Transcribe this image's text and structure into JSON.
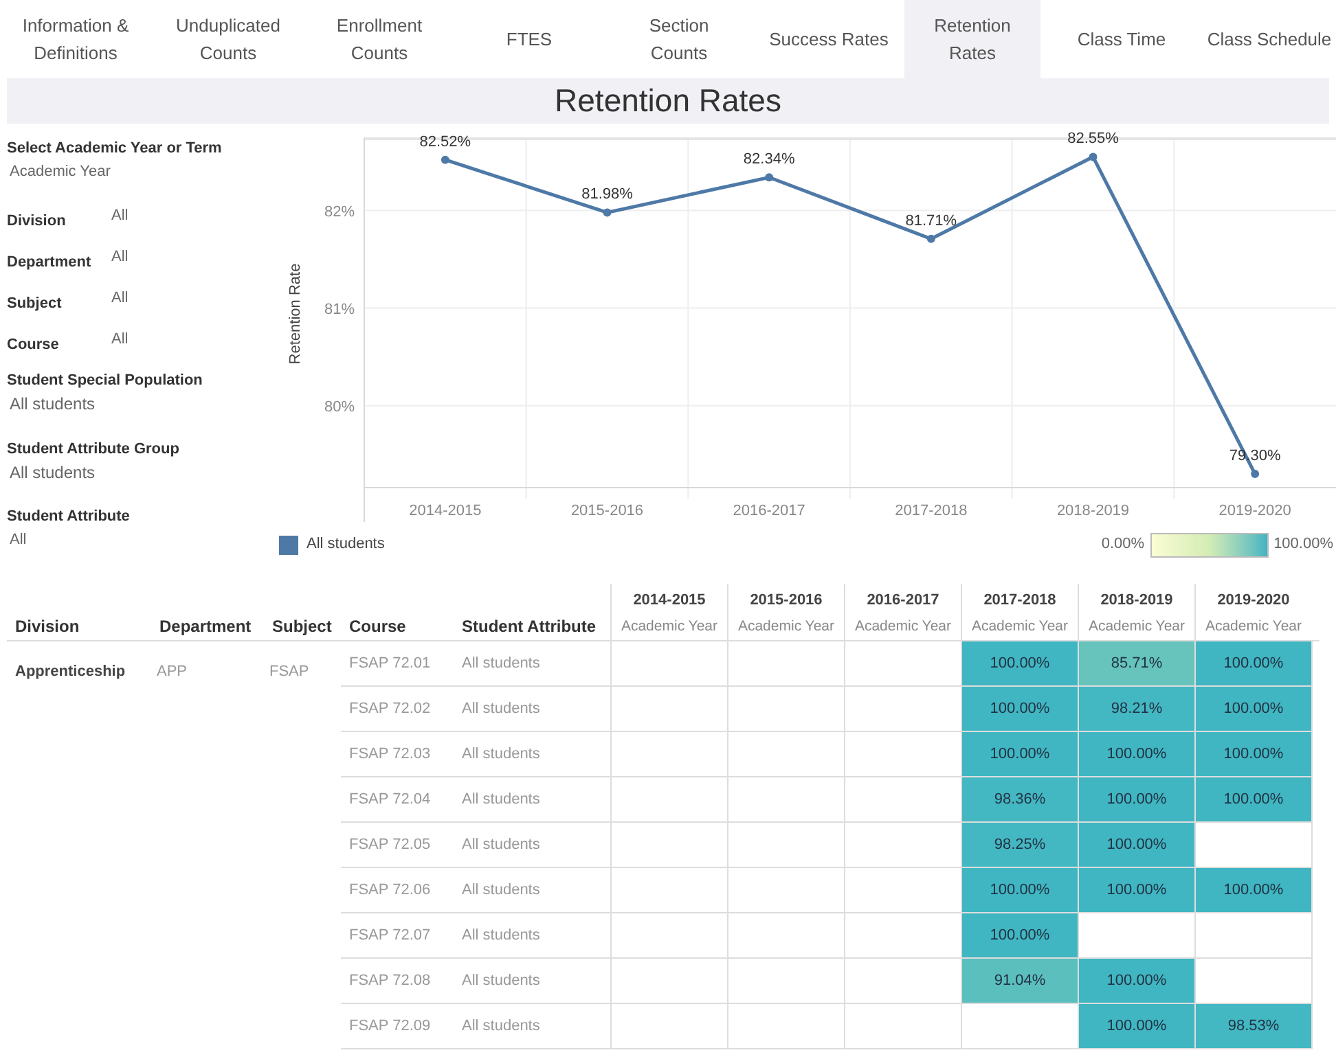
{
  "tabs": [
    {
      "label": "Information & Definitions",
      "selected": false
    },
    {
      "label": "Unduplicated Counts",
      "selected": false
    },
    {
      "label": "Enrollment Counts",
      "selected": false
    },
    {
      "label": "FTES",
      "selected": false
    },
    {
      "label": "Section Counts",
      "selected": false
    },
    {
      "label": "Success Rates",
      "selected": false
    },
    {
      "label": "Retention Rates",
      "selected": true
    },
    {
      "label": "Class Time",
      "selected": false
    },
    {
      "label": "Class Schedule",
      "selected": false
    }
  ],
  "title": "Retention Rates",
  "filters": [
    {
      "kind": "stacked",
      "label": "Select Academic Year or Term",
      "value": "Academic Year"
    },
    {
      "kind": "inline",
      "label": "Division",
      "value": "All"
    },
    {
      "kind": "inline",
      "label": "Department",
      "value": "All"
    },
    {
      "kind": "inline",
      "label": "Subject",
      "value": "All"
    },
    {
      "kind": "inline",
      "label": "Course",
      "value": "All"
    },
    {
      "kind": "stacked",
      "label": "Student Special Population",
      "value": "All students"
    },
    {
      "kind": "stacked",
      "label": "Student Attribute Group",
      "value": "All students"
    },
    {
      "kind": "stacked",
      "label": "Student Attribute",
      "value": "All"
    }
  ],
  "chart_data": {
    "type": "line",
    "ylabel": "Retention Rate",
    "categories": [
      "2014-2015",
      "2015-2016",
      "2016-2017",
      "2017-2018",
      "2018-2019",
      "2019-2020"
    ],
    "series": [
      {
        "name": "All students",
        "color": "#4e79a7",
        "values": [
          82.52,
          81.98,
          82.34,
          81.71,
          82.55,
          79.3
        ]
      }
    ],
    "ylim": [
      79.16,
      82.75
    ],
    "yticks": [
      {
        "value": 80,
        "label": "80%"
      },
      {
        "value": 81,
        "label": "81%"
      },
      {
        "value": 82,
        "label": "82%"
      }
    ],
    "grid": true,
    "marker": true,
    "value_labels": [
      "82.52%",
      "81.98%",
      "82.34%",
      "81.71%",
      "82.55%",
      "79.30%"
    ]
  },
  "color_legend": {
    "min": "0.00%",
    "max": "100.00%"
  },
  "table": {
    "columns": [
      "Division",
      "Department",
      "Subject",
      "Course",
      "Student Attribute"
    ],
    "years": [
      {
        "year": "2014-2015",
        "term": "Academic Year"
      },
      {
        "year": "2015-2016",
        "term": "Academic Year"
      },
      {
        "year": "2016-2017",
        "term": "Academic Year"
      },
      {
        "year": "2017-2018",
        "term": "Academic Year"
      },
      {
        "year": "2018-2019",
        "term": "Academic Year"
      },
      {
        "year": "2019-2020",
        "term": "Academic Year"
      }
    ],
    "group": {
      "division": "Apprenticeship",
      "department": "APP",
      "subject": "FSAP"
    },
    "rows": [
      {
        "course": "FSAP 72.01",
        "attribute": "All students",
        "cells": [
          null,
          null,
          null,
          {
            "value": "100.00%",
            "color": "#40b6c2"
          },
          {
            "value": "85.71%",
            "color": "#66c4bc"
          },
          {
            "value": "100.00%",
            "color": "#40b6c2"
          }
        ]
      },
      {
        "course": "FSAP 72.02",
        "attribute": "All students",
        "cells": [
          null,
          null,
          null,
          {
            "value": "100.00%",
            "color": "#40b6c2"
          },
          {
            "value": "98.21%",
            "color": "#43b7c2"
          },
          {
            "value": "100.00%",
            "color": "#40b6c2"
          }
        ]
      },
      {
        "course": "FSAP 72.03",
        "attribute": "All students",
        "cells": [
          null,
          null,
          null,
          {
            "value": "100.00%",
            "color": "#40b6c2"
          },
          {
            "value": "100.00%",
            "color": "#40b6c2"
          },
          {
            "value": "100.00%",
            "color": "#40b6c2"
          }
        ]
      },
      {
        "course": "FSAP 72.04",
        "attribute": "All students",
        "cells": [
          null,
          null,
          null,
          {
            "value": "98.36%",
            "color": "#43b7c2"
          },
          {
            "value": "100.00%",
            "color": "#40b6c2"
          },
          {
            "value": "100.00%",
            "color": "#40b6c2"
          }
        ]
      },
      {
        "course": "FSAP 72.05",
        "attribute": "All students",
        "cells": [
          null,
          null,
          null,
          {
            "value": "98.25%",
            "color": "#44b8c2"
          },
          {
            "value": "100.00%",
            "color": "#40b6c2"
          },
          null
        ]
      },
      {
        "course": "FSAP 72.06",
        "attribute": "All students",
        "cells": [
          null,
          null,
          null,
          {
            "value": "100.00%",
            "color": "#40b6c2"
          },
          {
            "value": "100.00%",
            "color": "#40b6c2"
          },
          {
            "value": "100.00%",
            "color": "#40b6c2"
          }
        ]
      },
      {
        "course": "FSAP 72.07",
        "attribute": "All students",
        "cells": [
          null,
          null,
          null,
          {
            "value": "100.00%",
            "color": "#40b6c2"
          },
          null,
          null
        ]
      },
      {
        "course": "FSAP 72.08",
        "attribute": "All students",
        "cells": [
          null,
          null,
          null,
          {
            "value": "91.04%",
            "color": "#5bbfbe"
          },
          {
            "value": "100.00%",
            "color": "#40b6c2"
          },
          null
        ]
      },
      {
        "course": "FSAP 72.09",
        "attribute": "All students",
        "cells": [
          null,
          null,
          null,
          null,
          {
            "value": "100.00%",
            "color": "#40b6c2"
          },
          {
            "value": "98.53%",
            "color": "#43b7c2"
          }
        ]
      }
    ]
  }
}
